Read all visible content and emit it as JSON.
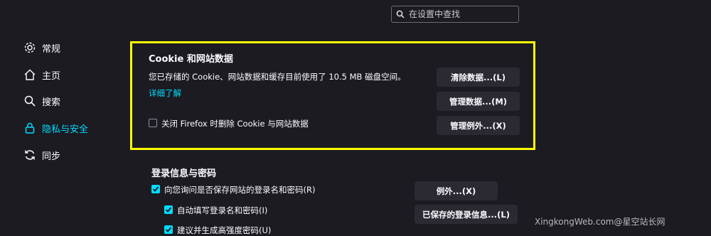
{
  "search": {
    "placeholder": "在设置中查找"
  },
  "sidebar": {
    "items": [
      {
        "label": "常规",
        "icon": "gear-icon"
      },
      {
        "label": "主页",
        "icon": "home-icon"
      },
      {
        "label": "搜索",
        "icon": "search-icon"
      },
      {
        "label": "隐私与安全",
        "icon": "lock-icon",
        "active": true
      },
      {
        "label": "同步",
        "icon": "sync-icon"
      }
    ]
  },
  "cookies": {
    "title": "Cookie 和网站数据",
    "description": "您已存储的 Cookie、网站数据和缓存目前使用了 10.5 MB 磁盘空间。",
    "learn_more": "详细了解",
    "delete_on_close_label": "关闭 Firefox 时删除 Cookie 与网站数据",
    "delete_on_close_checked": false,
    "clear_button": "清除数据...(L)",
    "manage_button": "管理数据...(M)",
    "exceptions_button": "管理例外...(X)"
  },
  "logins": {
    "title": "登录信息与密码",
    "ask_save_label": "向您询问是否保存网站的登录名和密码(R)",
    "autofill_label": "自动填写登录名和密码(I)",
    "suggest_label": "建议并生成高强度密码(U)",
    "exceptions_button": "例外...(X)",
    "saved_logins_button": "已保存的登录信息...(L)"
  },
  "watermark": "XingkongWeb.com@星空站长网",
  "colors": {
    "accent": "#00ddff",
    "highlight": "#ffff00",
    "background": "#1c1b22",
    "button": "#2b2a33"
  }
}
